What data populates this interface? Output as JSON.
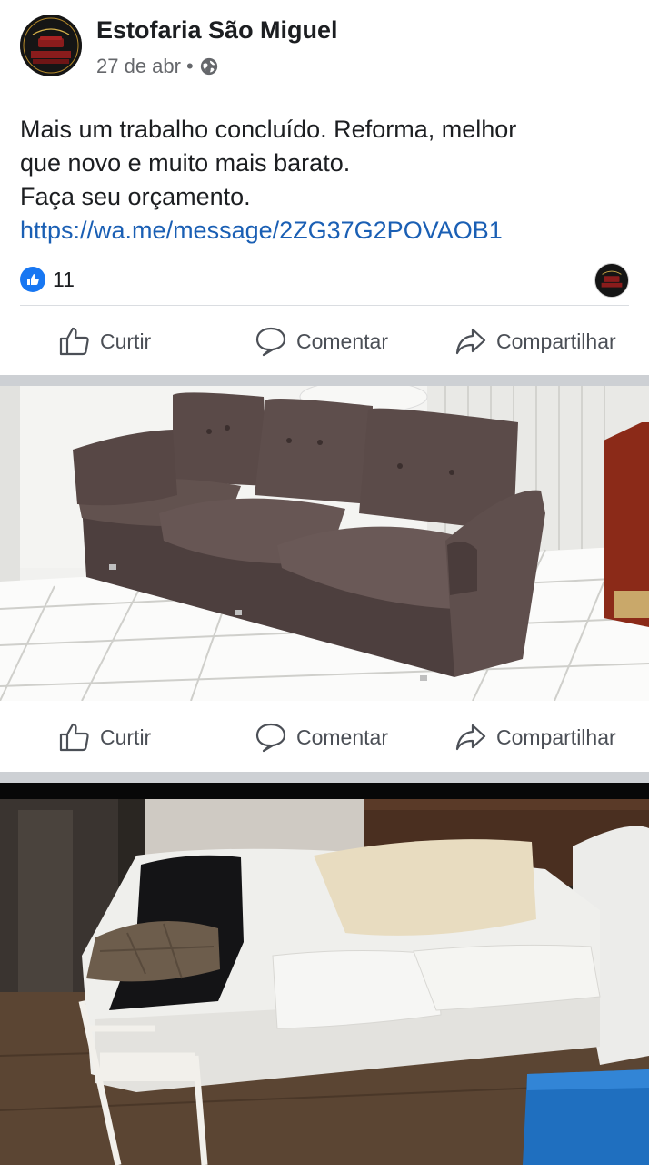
{
  "post": {
    "author": "Estofaria São Miguel",
    "date": "27 de abr",
    "separator": "•",
    "text_lines": [
      "Mais um trabalho concluído.  Reforma, melhor",
      "que novo e muito mais barato.",
      "Faça seu orçamento."
    ],
    "link": "https://wa.me/message/2ZG37G2POVAOB1",
    "like_count": "11",
    "avatar_text": "ESTOFARIA SÃO MIGUEL"
  },
  "actions": {
    "like_label": "Curtir",
    "comment_label": "Comentar",
    "share_label": "Compartilhar"
  },
  "photos": [
    {
      "name": "reupholstered-brown-sofa"
    },
    {
      "name": "old-white-sofa-before"
    }
  ],
  "colors": {
    "link": "#1a5fb4",
    "like_badge": "#1877f2",
    "muted_text": "#65676b",
    "separator_band": "#cdd0d4"
  },
  "icons": [
    "globe-icon",
    "like-icon",
    "comment-icon",
    "share-icon",
    "thumbs-up-badge-icon"
  ]
}
